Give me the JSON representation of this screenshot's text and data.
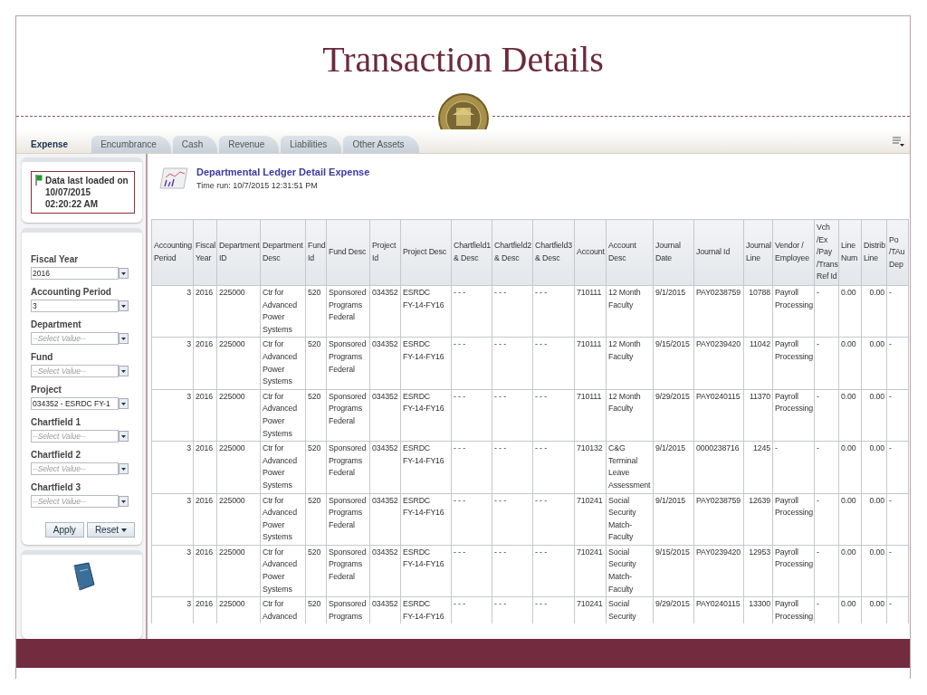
{
  "slide": {
    "title": "Transaction Details"
  },
  "tabs": [
    {
      "label": "Expense",
      "selected": true
    },
    {
      "label": "Encumbrance",
      "selected": false
    },
    {
      "label": "Cash",
      "selected": false
    },
    {
      "label": "Revenue",
      "selected": false
    },
    {
      "label": "Liabilities",
      "selected": false
    },
    {
      "label": "Other Assets",
      "selected": false
    }
  ],
  "data_status": {
    "lines": [
      "Data last loaded on",
      "10/07/2015",
      "02:20:22 AM"
    ]
  },
  "filters": [
    {
      "label": "Fiscal Year",
      "value": "2016"
    },
    {
      "label": "Accounting Period",
      "value": "3"
    },
    {
      "label": "Department",
      "placeholder": "--Select Value--"
    },
    {
      "label": "Fund",
      "placeholder": "--Select Value--"
    },
    {
      "label": "Project",
      "value": "034352 - ESRDC FY-1"
    },
    {
      "label": "Chartfield 1",
      "placeholder": "--Select Value--"
    },
    {
      "label": "Chartfield 2",
      "placeholder": "--Select Value--"
    },
    {
      "label": "Chartfield 3",
      "placeholder": "--Select Value--"
    }
  ],
  "filter_buttons": [
    {
      "label": "Apply",
      "kind": "plain"
    },
    {
      "label": "Reset",
      "kind": "menu"
    }
  ],
  "report": {
    "title": "Departmental Ledger Detail Expense",
    "time_run": "Time run: 10/7/2015 12:31:51 PM"
  },
  "table": {
    "columns": [
      "Accounting Period",
      "Fiscal Year",
      "Department ID",
      "Department Desc",
      "Fund Id",
      "Fund Desc",
      "Project Id",
      "Project Desc",
      "Chartfield1 & Desc",
      "Chartfield2 & Desc",
      "Chartfield3 & Desc",
      "Account",
      "Account Desc",
      "Journal Date",
      "Journal Id",
      "Journal Line",
      "Vendor / Employee",
      "Vch /Ex /Pay /Trans Ref Id",
      "Line Num",
      "Distrib Line",
      "Po /TAu Dep"
    ],
    "rows": [
      [
        "3",
        "2016",
        "225000",
        "Ctr for Advanced Power Systems",
        "520",
        "Sponsored Programs Federal",
        "034352",
        "ESRDC FY-14-FY16",
        "- - -",
        "- - -",
        "- - -",
        "710111",
        "12 Month Faculty",
        "9/1/2015",
        "PAY0238759",
        "10788",
        "Payroll Processing",
        "-",
        "0.00",
        "0.00",
        "-"
      ],
      [
        "3",
        "2016",
        "225000",
        "Ctr for Advanced Power Systems",
        "520",
        "Sponsored Programs Federal",
        "034352",
        "ESRDC FY-14-FY16",
        "- - -",
        "- - -",
        "- - -",
        "710111",
        "12 Month Faculty",
        "9/15/2015",
        "PAY0239420",
        "11042",
        "Payroll Processing",
        "-",
        "0.00",
        "0.00",
        "-"
      ],
      [
        "3",
        "2016",
        "225000",
        "Ctr for Advanced Power Systems",
        "520",
        "Sponsored Programs Federal",
        "034352",
        "ESRDC FY-14-FY16",
        "- - -",
        "- - -",
        "- - -",
        "710111",
        "12 Month Faculty",
        "9/29/2015",
        "PAY0240115",
        "11370",
        "Payroll Processing",
        "-",
        "0.00",
        "0.00",
        "-"
      ],
      [
        "3",
        "2016",
        "225000",
        "Ctr for Advanced Power Systems",
        "520",
        "Sponsored Programs Federal",
        "034352",
        "ESRDC FY-14-FY16",
        "- - -",
        "- - -",
        "- - -",
        "710132",
        "C&G Terminal Leave Assessment",
        "9/1/2015",
        "0000238716",
        "1245",
        "-",
        "-",
        "0.00",
        "0.00",
        "-"
      ],
      [
        "3",
        "2016",
        "225000",
        "Ctr for Advanced Power Systems",
        "520",
        "Sponsored Programs Federal",
        "034352",
        "ESRDC FY-14-FY16",
        "- - -",
        "- - -",
        "- - -",
        "710241",
        "Social Security Match-Faculty",
        "9/1/2015",
        "PAY0238759",
        "12639",
        "Payroll Processing",
        "-",
        "0.00",
        "0.00",
        "-"
      ],
      [
        "3",
        "2016",
        "225000",
        "Ctr for Advanced Power Systems",
        "520",
        "Sponsored Programs Federal",
        "034352",
        "ESRDC FY-14-FY16",
        "- - -",
        "- - -",
        "- - -",
        "710241",
        "Social Security Match-Faculty",
        "9/15/2015",
        "PAY0239420",
        "12953",
        "Payroll Processing",
        "-",
        "0.00",
        "0.00",
        "-"
      ],
      [
        "3",
        "2016",
        "225000",
        "Ctr for Advanced",
        "520",
        "Sponsored Programs",
        "034352",
        "ESRDC FY-14-FY16",
        "- - -",
        "- - -",
        "- - -",
        "710241",
        "Social Security",
        "9/29/2015",
        "PAY0240115",
        "13300",
        "Payroll Processing",
        "-",
        "0.00",
        "0.00",
        "-"
      ]
    ]
  }
}
